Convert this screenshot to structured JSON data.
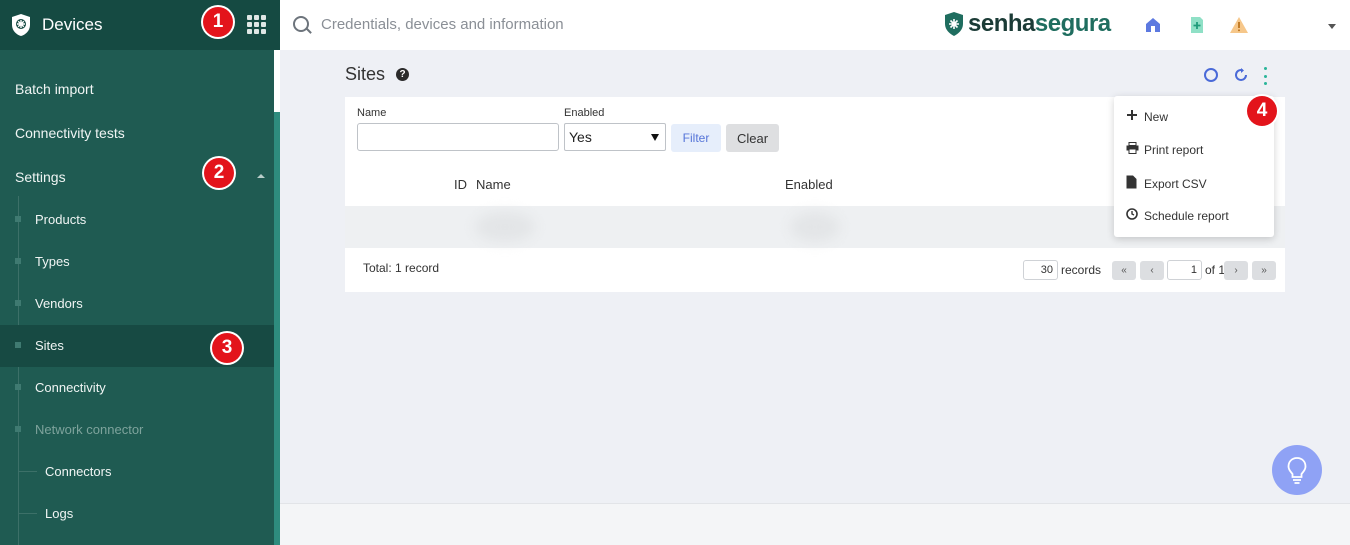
{
  "sidebar": {
    "title": "Devices",
    "items": [
      {
        "label": "Batch import"
      },
      {
        "label": "Connectivity tests"
      },
      {
        "label": "Settings"
      }
    ],
    "settings_children": [
      {
        "label": "Products"
      },
      {
        "label": "Types"
      },
      {
        "label": "Vendors"
      },
      {
        "label": "Sites"
      },
      {
        "label": "Connectivity"
      },
      {
        "label": "Network connector"
      }
    ],
    "network_children": [
      {
        "label": "Connectors"
      },
      {
        "label": "Logs"
      }
    ]
  },
  "steps": [
    "1",
    "2",
    "3",
    "4"
  ],
  "topbar": {
    "search_placeholder": "Credentials, devices and information",
    "brand_part1": "senha",
    "brand_part2": "segura"
  },
  "page": {
    "title": "Sites",
    "help_glyph": "?"
  },
  "filters": {
    "name_label": "Name",
    "name_value": "",
    "enabled_label": "Enabled",
    "enabled_value": "Yes",
    "filter_button": "Filter",
    "clear_button": "Clear"
  },
  "table": {
    "columns": [
      "ID",
      "Name",
      "Enabled"
    ],
    "total": "Total: 1 record"
  },
  "pagination": {
    "per_page": "30",
    "records_label": "records",
    "page": "1",
    "of_label": "of 1",
    "first": "«",
    "prev": "‹",
    "next": "›",
    "last": "»"
  },
  "menu": {
    "items": [
      {
        "label": "New",
        "icon": "plus-icon"
      },
      {
        "label": "Print report",
        "icon": "printer-icon"
      },
      {
        "label": "Export CSV",
        "icon": "file-icon"
      },
      {
        "label": "Schedule report",
        "icon": "clock-icon"
      }
    ]
  },
  "colors": {
    "sidebar": "#1f5b52",
    "sidebar_header": "#154a42",
    "accent": "#2bb59a",
    "step_badge": "#e3141b",
    "link_blue": "#4a6ad8"
  }
}
